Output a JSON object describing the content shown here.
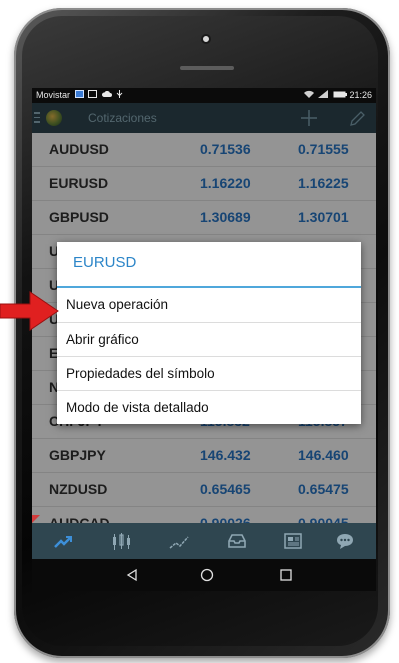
{
  "statusbar": {
    "carrier": "Movistar",
    "time": "21:26"
  },
  "appbar": {
    "title": "Cotizaciones"
  },
  "quotes": [
    {
      "symbol": "AUDUSD",
      "bid": "0.71536",
      "ask": "0.71555"
    },
    {
      "symbol": "EURUSD",
      "bid": "1.16220",
      "ask": "1.16225"
    },
    {
      "symbol": "GBPUSD",
      "bid": "1.30689",
      "ask": "1.30701"
    },
    {
      "symbol": "U",
      "bid": "",
      "ask": "5"
    },
    {
      "symbol": "U",
      "bid": "",
      "ask": "8"
    },
    {
      "symbol": "U",
      "bid": "",
      "ask": "8"
    },
    {
      "symbol": "E",
      "bid": "",
      "ask": "8"
    },
    {
      "symbol": "N",
      "bid": "",
      "ask": "9"
    },
    {
      "symbol": "CHFJPY",
      "bid": "115.832",
      "ask": "115.857"
    },
    {
      "symbol": "GBPJPY",
      "bid": "146.432",
      "ask": "146.460"
    },
    {
      "symbol": "NZDUSD",
      "bid": "0.65465",
      "ask": "0.65475"
    },
    {
      "symbol": "AUDCAD",
      "bid": "0.90026",
      "ask": "0.90045"
    }
  ],
  "dialog": {
    "title": "EURUSD",
    "items": [
      "Nueva operación",
      "Abrir gráfico",
      "Propiedades del símbolo",
      "Modo de vista detallado"
    ]
  },
  "colors": {
    "appbar": "#2f4650",
    "accent": "#2b85c8",
    "price": "#2977c9",
    "arrow": "#e02020"
  },
  "icons": {
    "toolbar": [
      "quotes-icon",
      "chart-candles-icon",
      "trend-icon",
      "inbox-icon",
      "news-icon",
      "chat-icon"
    ],
    "nav": [
      "back-icon",
      "home-icon",
      "recents-icon"
    ]
  }
}
